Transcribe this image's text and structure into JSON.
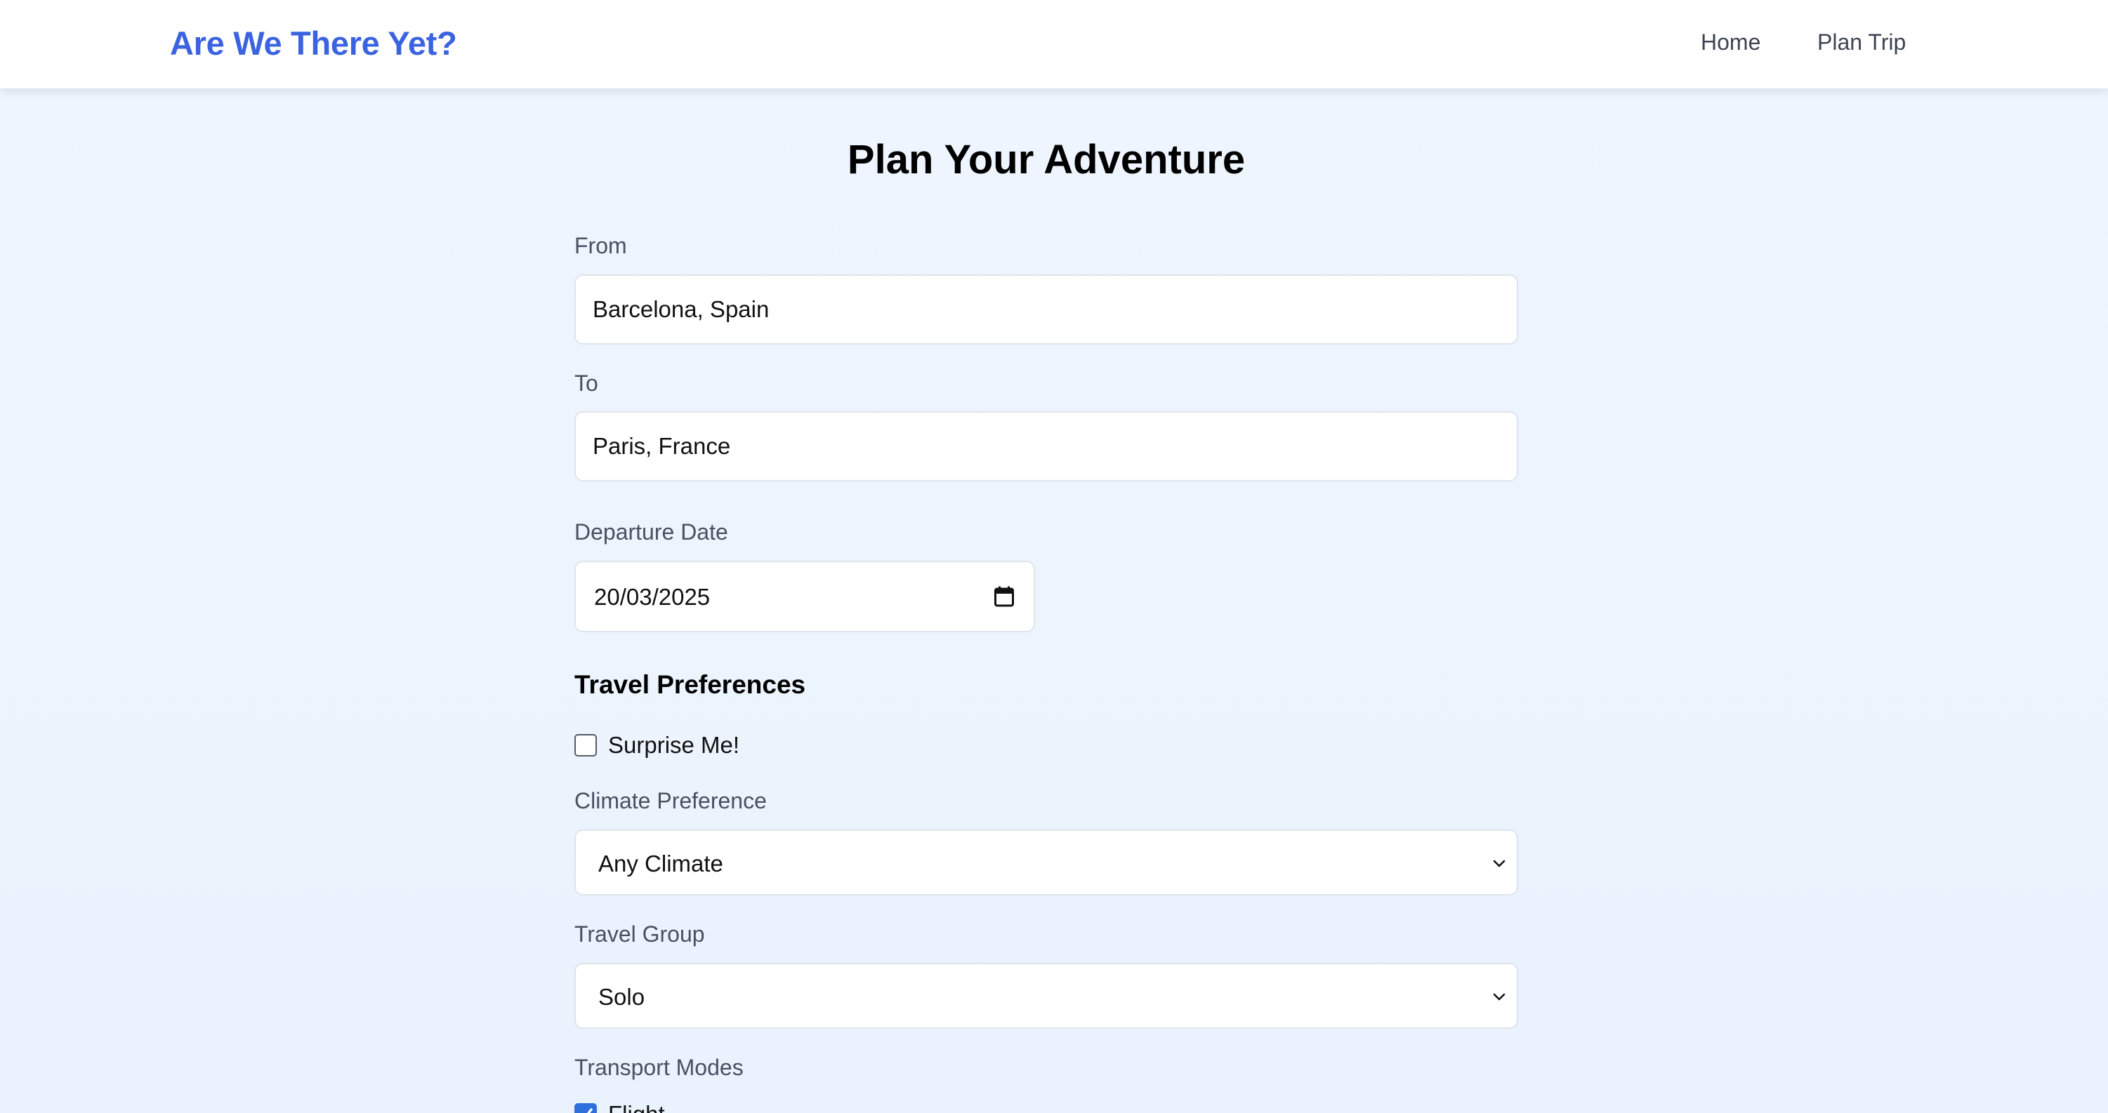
{
  "header": {
    "brand": "Are We There Yet?",
    "nav": [
      {
        "label": "Home"
      },
      {
        "label": "Plan Trip"
      }
    ]
  },
  "page": {
    "title": "Plan Your Adventure"
  },
  "form": {
    "from": {
      "label": "From",
      "value": "Barcelona, Spain"
    },
    "to": {
      "label": "To",
      "value": "Paris, France"
    },
    "departure": {
      "label": "Departure Date",
      "value": "20/03/2025",
      "icon": "calendar-icon"
    },
    "preferences_heading": "Travel Preferences",
    "surprise": {
      "label": "Surprise Me!",
      "checked": false
    },
    "climate": {
      "label": "Climate Preference",
      "value": "Any Climate",
      "icon": "chevron-down-icon"
    },
    "group": {
      "label": "Travel Group",
      "value": "Solo",
      "icon": "chevron-down-icon"
    },
    "transport": {
      "label": "Transport Modes",
      "options": [
        {
          "label": "Flight",
          "checked": true
        }
      ]
    }
  },
  "colors": {
    "brand": "#3b63e0",
    "checkbox_checked": "#2f6fdb",
    "background": "#eef5fe"
  }
}
